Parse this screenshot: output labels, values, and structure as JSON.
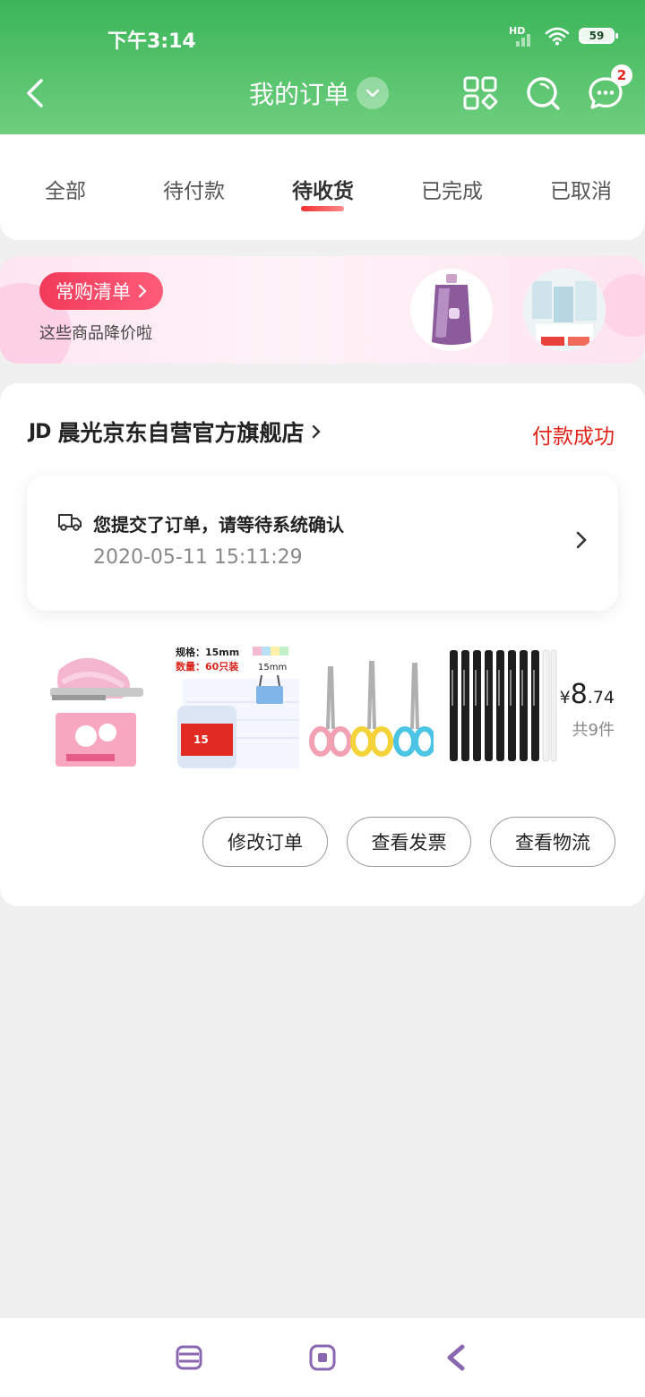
{
  "status_bar": {
    "time": "下午3:14",
    "network": "HD",
    "battery": "59"
  },
  "nav": {
    "title": "我的订单",
    "icons": [
      "back-icon",
      "chevron-down-icon",
      "grid-icon",
      "search-icon",
      "message-icon"
    ],
    "message_badge": "2"
  },
  "tabs": [
    {
      "label": "全部"
    },
    {
      "label": "待付款"
    },
    {
      "label": "待收货",
      "active": true
    },
    {
      "label": "已完成"
    },
    {
      "label": "已取消"
    }
  ],
  "promo": {
    "tag": "常购清单",
    "subtitle": "这些商品降价啦"
  },
  "order": {
    "store_logo": "JD",
    "store_name": "晨光京东自营官方旗舰店",
    "status": "付款成功",
    "notice_text": "您提交了订单，请等待系统确认",
    "notice_time": "2020-05-11 15:11:29",
    "products": [
      {
        "name": "stapler"
      },
      {
        "name": "binder-clips",
        "label_spec": "规格：15mm",
        "label_qty": "数量：60只装",
        "size_mark": "15mm",
        "tub_text": "15"
      },
      {
        "name": "scissors"
      },
      {
        "name": "gel-pens"
      }
    ],
    "price_symbol": "¥",
    "price_int": "8",
    "price_dec": ".74",
    "item_count": "共9件",
    "buttons": [
      "修改订单",
      "查看发票",
      "查看物流"
    ]
  },
  "colors": {
    "brand_green": "#3bb558",
    "accent_red": "#e2231a",
    "promo_pink": "#f23a5a"
  }
}
